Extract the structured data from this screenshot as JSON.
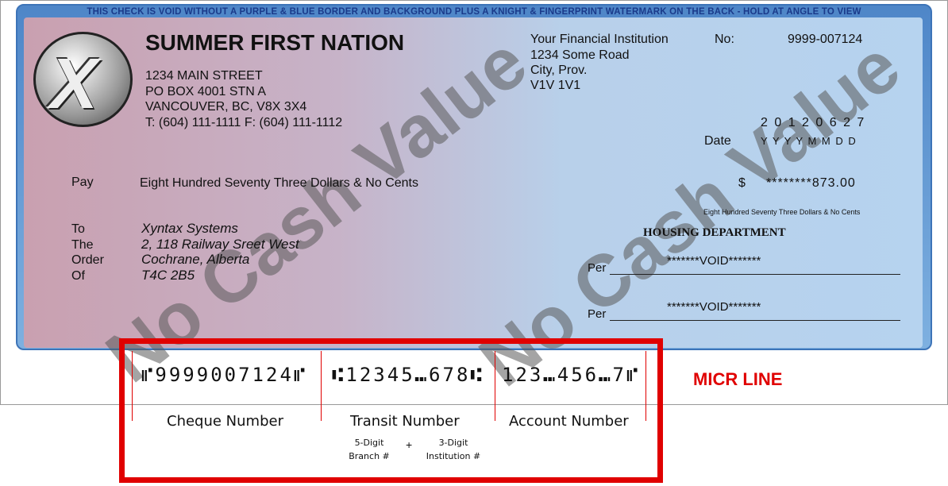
{
  "banner": "THIS CHECK IS VOID WITHOUT A PURPLE & BLUE BORDER AND BACKGROUND PLUS A KNIGHT & FINGERPRINT WATERMARK ON THE BACK - HOLD AT ANGLE TO VIEW",
  "issuer": {
    "name": "SUMMER FIRST NATION",
    "address1": "1234 MAIN STREET",
    "address2": "PO BOX 4001 STN A",
    "address3": "VANCOUVER, BC, V8X 3X4",
    "phones": "T: (604) 111-1111  F: (604) 111-1112",
    "logo_text": "X"
  },
  "bank": {
    "name": "Your Financial Institution",
    "address1": "1234 Some Road",
    "address2": "City, Prov.",
    "address3": "V1V 1V1"
  },
  "cheque_no_label": "No:",
  "cheque_no": "9999-007124",
  "date": {
    "label": "Date",
    "value": "2 0 1 2 0 6 2 7",
    "format": "Y Y Y Y M M D D"
  },
  "pay": {
    "label": "Pay",
    "words": "Eight Hundred Seventy Three Dollars & No Cents",
    "currency": "$",
    "amount": "********873.00",
    "amount_words": "Eight Hundred Seventy Three Dollars & No Cents"
  },
  "payee": {
    "labels": [
      "To",
      "The",
      "Order",
      "Of"
    ],
    "lines": [
      "Xyntax Systems",
      "2, 118 Railway Sreet West",
      "Cochrane, Alberta",
      "T4C 2B5"
    ]
  },
  "signature": {
    "department": "HOUSING DEPARTMENT",
    "per_label": "Per",
    "void1": "*******VOID*******",
    "void2": "*******VOID*******"
  },
  "watermark": "No Cash Value",
  "micr": {
    "cheque": "⑈9999007124⑈",
    "transit": "⑆12345⑉678⑆",
    "account": "123⑉456⑉7⑈",
    "title": "MICR LINE",
    "cheque_label": "Cheque Number",
    "transit_label": "Transit Number",
    "account_label": "Account Number",
    "branch_top": "5-Digit",
    "branch_bottom": "Branch #",
    "plus": "+",
    "inst_top": "3-Digit",
    "inst_bottom": "Institution #"
  },
  "colors": {
    "accent_red": "#e00000",
    "border_blue": "#4e86c8"
  }
}
